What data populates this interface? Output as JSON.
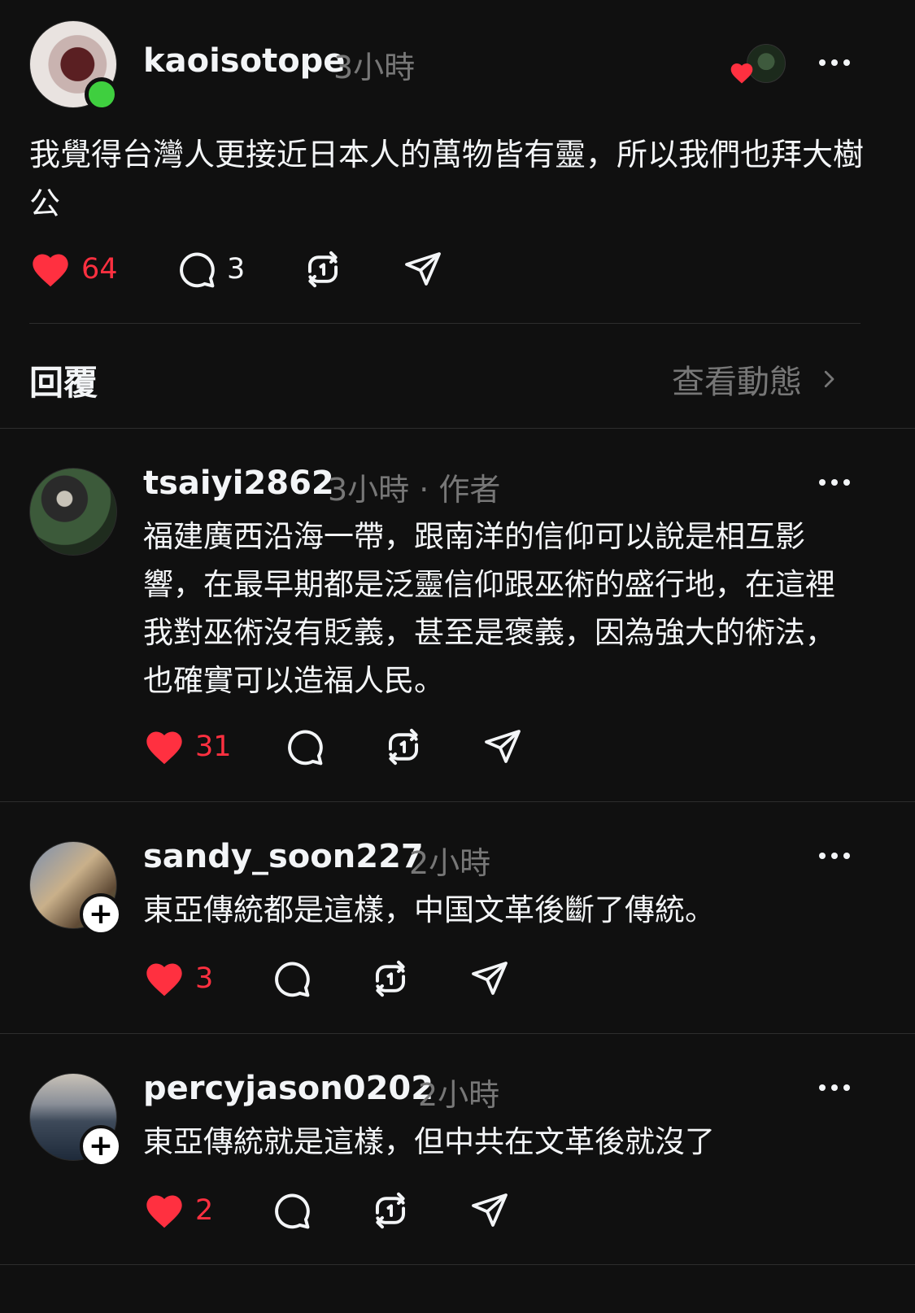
{
  "post": {
    "username": "kaoisotope",
    "time": "3小時",
    "text": "我覺得台灣人更接近日本人的萬物皆有靈，所以我們也拜大樹公",
    "likes": "64",
    "replies": "3"
  },
  "section": {
    "title": "回覆",
    "view_activity": "查看動態"
  },
  "replies": [
    {
      "username": "tsaiyi2862",
      "meta": "3小時 · 作者",
      "text": "福建廣西沿海一帶，跟南洋的信仰可以說是相互影響，在最早期都是泛靈信仰跟巫術的盛行地，在這裡我對巫術沒有貶義，甚至是褒義，因為強大的術法，也確實可以造福人民。",
      "likes": "31"
    },
    {
      "username": "sandy_soon227",
      "meta": "2小時",
      "text": "東亞傳統都是這樣，中国文革後斷了傳統。",
      "likes": "3"
    },
    {
      "username": "percyjason0202",
      "meta": "2小時",
      "text": "東亞傳統就是這樣，但中共在文革後就沒了",
      "likes": "2"
    }
  ],
  "colors": {
    "background": "#101010",
    "like_red": "#ff3040",
    "muted": "#777777",
    "online": "#3fcf3f"
  },
  "icons": [
    "heart-icon",
    "comment-icon",
    "repost-icon",
    "share-icon",
    "more-icon",
    "chevron-right-icon",
    "plus-icon"
  ]
}
